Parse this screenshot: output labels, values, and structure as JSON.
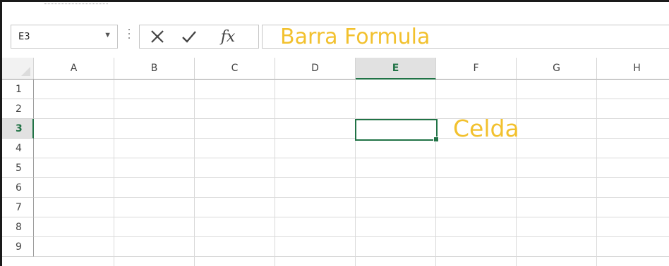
{
  "name_box": {
    "value": "E3"
  },
  "formula_bar": {
    "cancel_icon": "x-icon",
    "enter_icon": "check-icon",
    "insert_function_label": "fx",
    "content": "Barra Formula"
  },
  "columns": [
    "A",
    "B",
    "C",
    "D",
    "E",
    "F",
    "G",
    "H"
  ],
  "rows": [
    "1",
    "2",
    "3",
    "4",
    "5",
    "6",
    "7",
    "8",
    "9"
  ],
  "active_cell": {
    "column": "E",
    "row": "3"
  },
  "annotations": {
    "cell_label": "Celda"
  },
  "colors": {
    "accent": "#217346",
    "annotation": "#f2c12e"
  }
}
